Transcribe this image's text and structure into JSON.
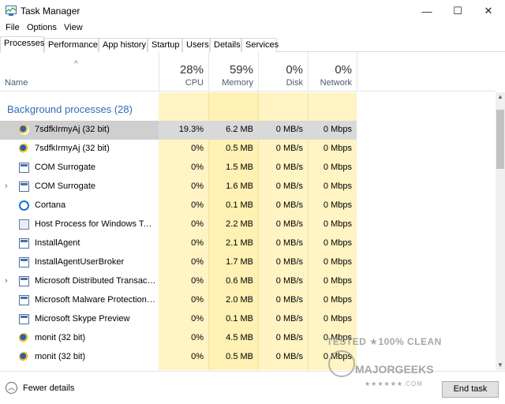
{
  "window": {
    "title": "Task Manager",
    "minimize_glyph": "—",
    "maximize_glyph": "☐",
    "close_glyph": "✕"
  },
  "menu": [
    "File",
    "Options",
    "View"
  ],
  "tabs": [
    "Processes",
    "Performance",
    "App history",
    "Startup",
    "Users",
    "Details",
    "Services"
  ],
  "active_tab": "Processes",
  "header": {
    "name_label": "Name",
    "cpu": {
      "pct": "28%",
      "label": "CPU"
    },
    "memory": {
      "pct": "59%",
      "label": "Memory"
    },
    "disk": {
      "pct": "0%",
      "label": "Disk"
    },
    "network": {
      "pct": "0%",
      "label": "Network"
    }
  },
  "group": {
    "label": "Background processes (28)"
  },
  "rows": [
    {
      "name": "7sdfkIrmyAj (32 bit)",
      "cpu": "19.3%",
      "mem": "6.2 MB",
      "disk": "0 MB/s",
      "net": "0 Mbps",
      "icon": "swirl-icon",
      "expandable": false,
      "selected": true
    },
    {
      "name": "7sdfkIrmyAj (32 bit)",
      "cpu": "0%",
      "mem": "0.5 MB",
      "disk": "0 MB/s",
      "net": "0 Mbps",
      "icon": "swirl-icon",
      "expandable": false,
      "selected": false
    },
    {
      "name": "COM Surrogate",
      "cpu": "0%",
      "mem": "1.5 MB",
      "disk": "0 MB/s",
      "net": "0 Mbps",
      "icon": "app-window-icon",
      "expandable": false,
      "selected": false
    },
    {
      "name": "COM Surrogate",
      "cpu": "0%",
      "mem": "1.6 MB",
      "disk": "0 MB/s",
      "net": "0 Mbps",
      "icon": "app-window-icon",
      "expandable": true,
      "selected": false
    },
    {
      "name": "Cortana",
      "cpu": "0%",
      "mem": "0.1 MB",
      "disk": "0 MB/s",
      "net": "0 Mbps",
      "icon": "cortana-icon",
      "expandable": false,
      "selected": false
    },
    {
      "name": "Host Process for Windows Tasks",
      "cpu": "0%",
      "mem": "2.2 MB",
      "disk": "0 MB/s",
      "net": "0 Mbps",
      "icon": "host-process-icon",
      "expandable": false,
      "selected": false
    },
    {
      "name": "InstallAgent",
      "cpu": "0%",
      "mem": "2.1 MB",
      "disk": "0 MB/s",
      "net": "0 Mbps",
      "icon": "app-window-icon",
      "expandable": false,
      "selected": false
    },
    {
      "name": "InstallAgentUserBroker",
      "cpu": "0%",
      "mem": "1.7 MB",
      "disk": "0 MB/s",
      "net": "0 Mbps",
      "icon": "app-window-icon",
      "expandable": false,
      "selected": false
    },
    {
      "name": "Microsoft Distributed Transacti...",
      "cpu": "0%",
      "mem": "0.6 MB",
      "disk": "0 MB/s",
      "net": "0 Mbps",
      "icon": "app-window-icon",
      "expandable": true,
      "selected": false
    },
    {
      "name": "Microsoft Malware Protection C...",
      "cpu": "0%",
      "mem": "2.0 MB",
      "disk": "0 MB/s",
      "net": "0 Mbps",
      "icon": "app-window-icon",
      "expandable": false,
      "selected": false
    },
    {
      "name": "Microsoft Skype Preview",
      "cpu": "0%",
      "mem": "0.1 MB",
      "disk": "0 MB/s",
      "net": "0 Mbps",
      "icon": "app-window-icon",
      "expandable": false,
      "selected": false
    },
    {
      "name": "monit (32 bit)",
      "cpu": "0%",
      "mem": "4.5 MB",
      "disk": "0 MB/s",
      "net": "0 Mbps",
      "icon": "swirl-icon",
      "expandable": false,
      "selected": false
    },
    {
      "name": "monit (32 bit)",
      "cpu": "0%",
      "mem": "0.5 MB",
      "disk": "0 MB/s",
      "net": "0 Mbps",
      "icon": "swirl-icon",
      "expandable": false,
      "selected": false
    }
  ],
  "footer": {
    "fewer_details": "Fewer details",
    "end_task": "End task"
  },
  "watermark": {
    "line1": "TESTED ★100% CLEAN",
    "line2": "MAJORGEEKS",
    "line3": "★★★★★★.COM"
  }
}
